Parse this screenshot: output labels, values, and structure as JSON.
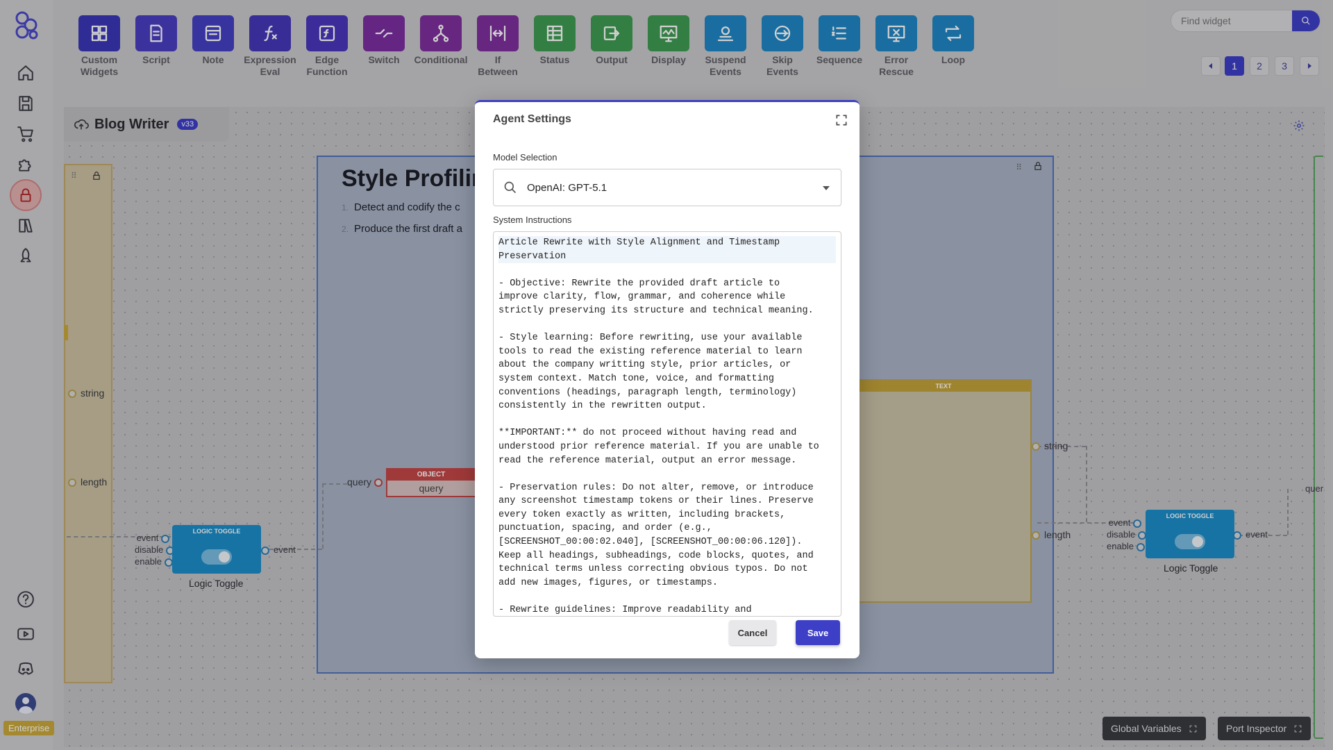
{
  "toolbar": {
    "tools": [
      {
        "label": "Custom\nWidgets",
        "icon": "grid-icon",
        "color": "#3a36b8"
      },
      {
        "label": "Script",
        "icon": "script-icon",
        "color": "#4a3ec0"
      },
      {
        "label": "Note",
        "icon": "note-icon",
        "color": "#4440c2"
      },
      {
        "label": "Expression\nEval",
        "icon": "function-icon",
        "color": "#4537b8"
      },
      {
        "label": "Edge\nFunction",
        "icon": "edge-function-icon",
        "color": "#4a36bb"
      },
      {
        "label": "Switch",
        "icon": "switch-icon",
        "color": "#7a2ea0"
      },
      {
        "label": "Conditional",
        "icon": "conditional-icon",
        "color": "#7e2f9c"
      },
      {
        "label": "If\nBetween",
        "icon": "if-between-icon",
        "color": "#7e2f9c"
      },
      {
        "label": "Status",
        "icon": "status-icon",
        "color": "#3f9a52"
      },
      {
        "label": "Output",
        "icon": "output-icon",
        "color": "#3f9a52"
      },
      {
        "label": "Display",
        "icon": "display-icon",
        "color": "#3f9a52"
      },
      {
        "label": "Suspend\nEvents",
        "icon": "suspend-icon",
        "color": "#1f86c4"
      },
      {
        "label": "Skip\nEvents",
        "icon": "skip-icon",
        "color": "#1f86c4"
      },
      {
        "label": "Sequence",
        "icon": "sequence-icon",
        "color": "#1f86c4"
      },
      {
        "label": "Error\nRescue",
        "icon": "error-rescue-icon",
        "color": "#1f86c4"
      },
      {
        "label": "Loop",
        "icon": "loop-icon",
        "color": "#1f86c4"
      }
    ],
    "search_placeholder": "Find widget",
    "pages": [
      "1",
      "2",
      "3"
    ],
    "active_page": "1"
  },
  "canvas": {
    "title": "Blog Writer",
    "version": "v33",
    "group_title": "Style Profilin",
    "group_items": [
      {
        "num": "1.",
        "text": "Detect and codify the c"
      },
      {
        "num": "2.",
        "text": "Produce the first draft a"
      }
    ],
    "left_ports": [
      "string",
      "length"
    ],
    "object_node": {
      "header": "OBJECT",
      "body": "query"
    },
    "query_label": "query",
    "text_node": {
      "header": "TEXT"
    },
    "text_ports": [
      "string",
      "length"
    ],
    "toggle_left": {
      "header": "LOGIC TOGGLE",
      "ports": [
        "event",
        "disable",
        "enable"
      ],
      "out": "event",
      "label": "Logic Toggle"
    },
    "toggle_right": {
      "header": "LOGIC TOGGLE",
      "ports": [
        "event",
        "disable",
        "enable"
      ],
      "out": "event",
      "label": "Logic Toggle"
    },
    "edge_query": "quer"
  },
  "sidebar": {
    "badge": "Enterprise"
  },
  "bottom": {
    "global_variables": "Global Variables",
    "port_inspector": "Port Inspector"
  },
  "modal": {
    "title": "Agent Settings",
    "model_label": "Model Selection",
    "model_value": "OpenAI: GPT-5.1",
    "instructions_label": "System Instructions",
    "instructions_first": "Article Rewrite with Style Alignment and Timestamp\nPreservation",
    "instructions_rest": "\n- Objective: Rewrite the provided draft article to\nimprove clarity, flow, grammar, and coherence while\nstrictly preserving its structure and technical meaning.\n\n- Style learning: Before rewriting, use your available\ntools to read the existing reference material to learn\nabout the company writting style, prior articles, or\nsystem context. Match tone, voice, and formatting\nconventions (headings, paragraph length, terminology)\nconsistently in the rewritten output.\n\n**IMPORTANT:** do not proceed without having read and\nunderstood prior reference material. If you are unable to\nread the reference material, output an error message.\n\n- Preservation rules: Do not alter, remove, or introduce\nany screenshot timestamp tokens or their lines. Preserve\nevery token exactly as written, including brackets,\npunctuation, spacing, and order (e.g.,\n[SCREENSHOT_00:00:02.040], [SCREENSHOT_00:00:06.120]).\nKeep all headings, subheadings, code blocks, quotes, and\ntechnical terms unless correcting obvious typos. Do not\nadd new images, figures, or timestamps.\n\n- Rewrite guidelines: Improve readability and",
    "cancel": "Cancel",
    "save": "Save"
  }
}
